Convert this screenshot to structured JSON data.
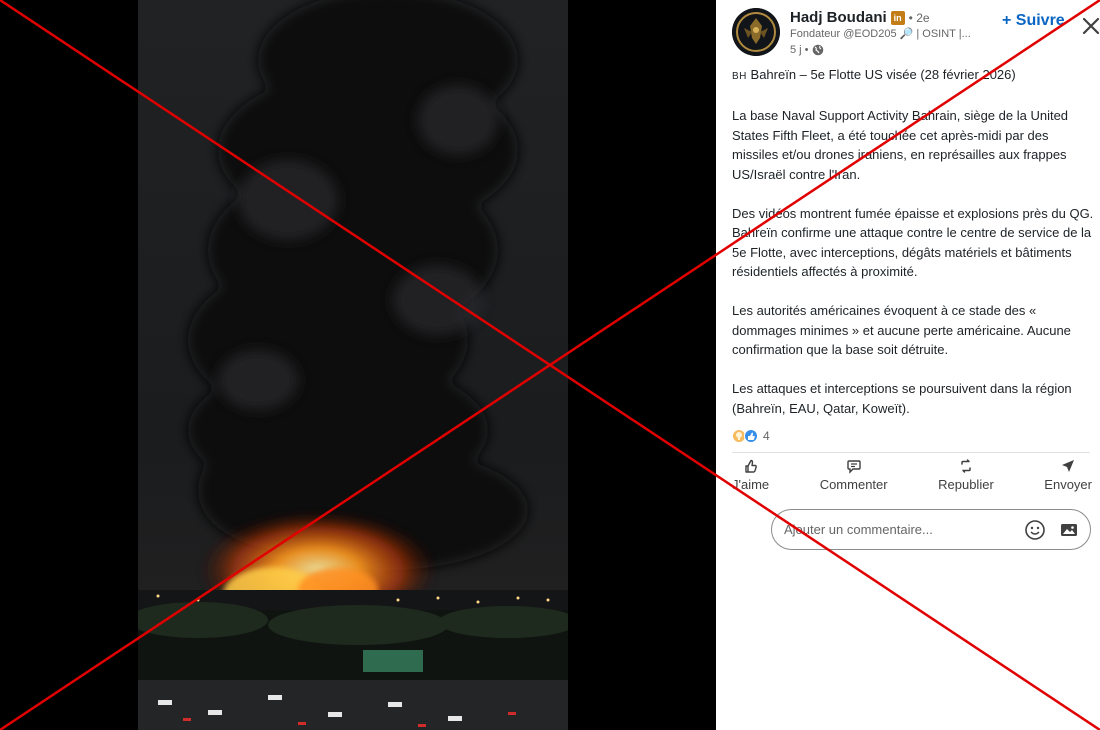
{
  "post": {
    "author": {
      "name": "Hadj Boudani",
      "linkedin_badge": "in",
      "degree": "• 2e",
      "headline": "Fondateur @EOD205 🔎 | OSINT |...",
      "time": "5 j •",
      "follow_label": "+ Suivre"
    },
    "title_flag": "BH",
    "title_text": " Bahreïn – 5e Flotte US visée (28 février 2026)",
    "paragraphs": [
      "La base Naval Support Activity Bahrain, siège de la United States Fifth Fleet, a été touchée cet après-midi par des missiles et/ou drones iraniens, en représailles aux frappes US/Israël contre l'Iran.",
      "Des vidéos montrent fumée épaisse et explosions près du QG. Bahreïn confirme une attaque contre le centre de service de la 5e Flotte, avec interceptions, dégâts matériels et bâtiments résidentiels affectés à proximité.",
      "Les autorités américaines évoquent à ce stade des « dommages minimes » et aucune perte américaine. Aucune confirmation que la base soit détruite.",
      "Les attaques et interceptions se poursuivent dans la région (Bahreïn, EAU, Qatar, Koweït)."
    ],
    "reactions_count": "4",
    "actions": {
      "like": "J'aime",
      "comment": "Commenter",
      "repost": "Republier",
      "send": "Envoyer"
    },
    "comment_placeholder": "Ajouter un commentaire..."
  },
  "colors": {
    "accent": "#0a66c2",
    "strike": "#e00000",
    "panel_bg": "#ffffff",
    "text": "#1d2226",
    "muted": "#666666"
  },
  "icons": [
    "linkedin-badge-icon",
    "globe-icon",
    "close-icon",
    "insightful-reaction-icon",
    "like-reaction-icon",
    "like-icon",
    "comment-icon",
    "repost-icon",
    "send-icon",
    "emoji-icon",
    "image-icon"
  ]
}
